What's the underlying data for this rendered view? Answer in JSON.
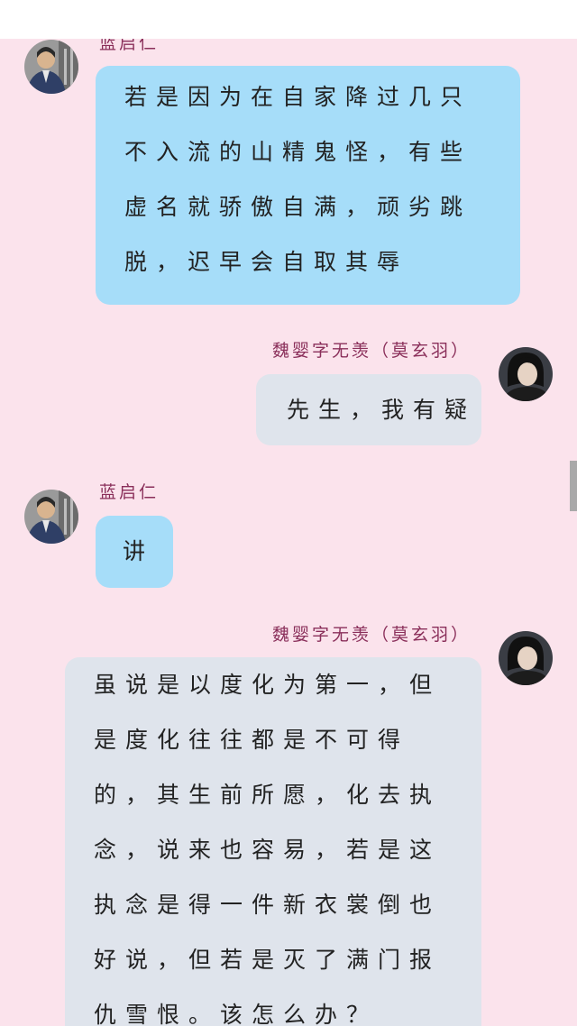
{
  "messages": [
    {
      "side": "left",
      "name": "蓝启仁",
      "text": "若是因为在自家降过几只不入流的山精鬼怪，有些虚名就骄傲自满，顽劣跳脱，迟早会自取其辱"
    },
    {
      "side": "right",
      "name": "魏婴字无羡（莫玄羽）",
      "text": "先生，我有疑"
    },
    {
      "side": "left",
      "name": "蓝启仁",
      "text": "讲"
    },
    {
      "side": "right",
      "name": "魏婴字无羡（莫玄羽）",
      "text": "虽说是以度化为第一，但是度化往往都是不可得的，其生前所愿，化去执念，说来也容易，若是这执念是得一件新衣裳倒也好说，但若是灭了满门报仇雪恨。该怎么办？"
    }
  ],
  "colors": {
    "background": "#fbe3ec",
    "left_bubble": "#a6ddf9",
    "right_bubble": "#dfe4ec",
    "name_text": "#8a2f5a"
  },
  "icons": {
    "left_avatar": "man-in-dark-robe-avatar",
    "right_avatar": "young-man-dark-hair-avatar"
  }
}
